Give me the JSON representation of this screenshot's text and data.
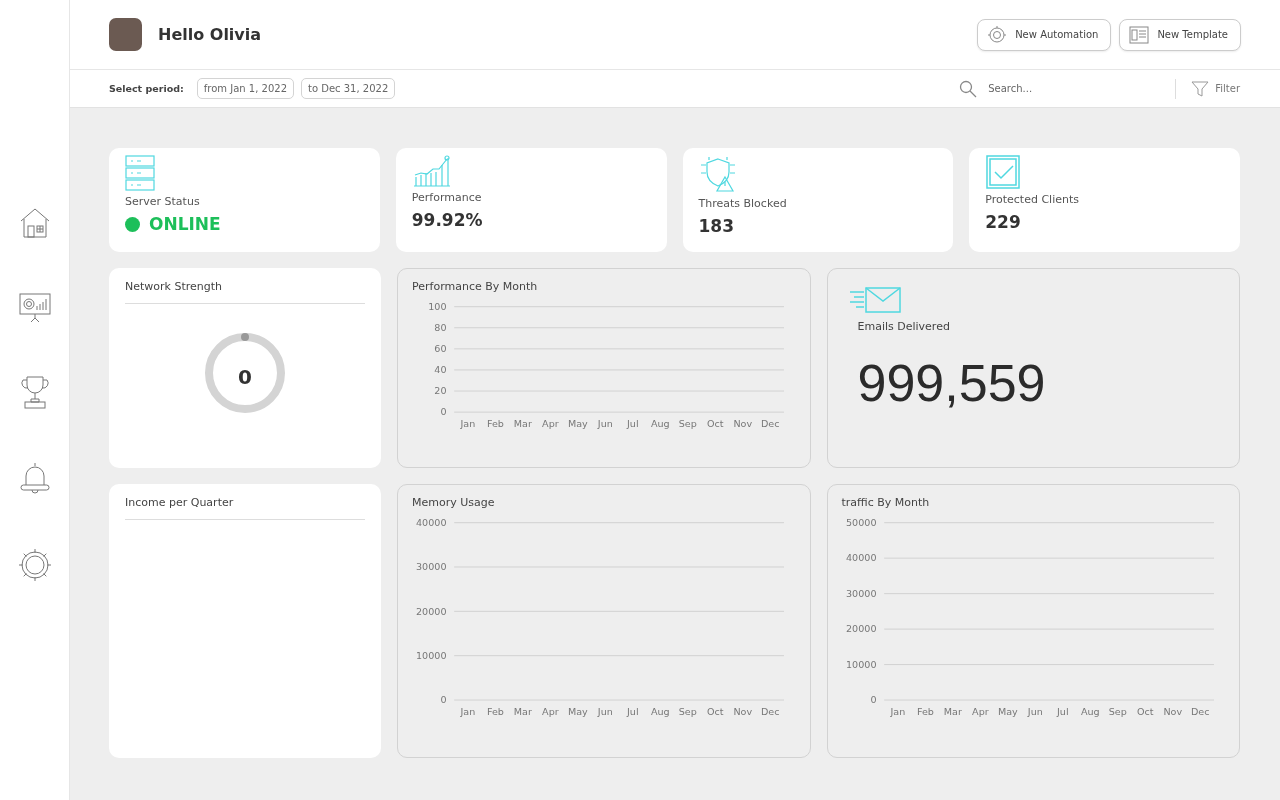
{
  "header": {
    "greeting": "Hello Olivia",
    "buttons": [
      {
        "label": "New Automation",
        "kind": "automation"
      },
      {
        "label": "New Template",
        "kind": "template"
      }
    ]
  },
  "period_bar": {
    "label": "Select period:",
    "from": "from Jan 1, 2022",
    "to": "to Dec 31, 2022",
    "search": {
      "placeholder": "Search..."
    },
    "filter": "Filter"
  },
  "stats": [
    {
      "kind": "server",
      "title": "Server Status",
      "status": {
        "label": "ONLINE",
        "color": "#1dbf5a"
      }
    },
    {
      "kind": "performance",
      "title": "Performance",
      "value": "99.92%"
    },
    {
      "kind": "threats",
      "title": "Threats Blocked",
      "value": "183"
    },
    {
      "kind": "clients",
      "title": "Protected Clients",
      "value": "229"
    }
  ],
  "network": {
    "title": "Network Strength",
    "level": 0,
    "reading": "0"
  },
  "performance_chart": {
    "title": "Performance By Month",
    "chart_data": {
      "type": "line",
      "categories": [
        "Jan",
        "Feb",
        "Mar",
        "Apr",
        "May",
        "Jun",
        "Jul",
        "Aug",
        "Sep",
        "Oct",
        "Nov",
        "Dec"
      ],
      "grid": true,
      "ylim": [
        0,
        100
      ],
      "yticks": [
        0,
        20,
        40,
        60,
        80,
        100
      ]
    }
  },
  "emails": {
    "title": "Emails Delivered",
    "value": "999,559"
  },
  "income": {
    "title": "Income per Quarter"
  },
  "memory_chart": {
    "title": "Memory Usage",
    "chart_data": {
      "type": "line",
      "categories": [
        "Jan",
        "Feb",
        "Mar",
        "Apr",
        "May",
        "Jun",
        "Jul",
        "Aug",
        "Sep",
        "Oct",
        "Nov",
        "Dec"
      ],
      "grid": true,
      "ylim": [
        0,
        40000
      ],
      "yticks": [
        0,
        10000,
        20000,
        30000,
        40000
      ]
    }
  },
  "traffic_chart": {
    "title": "traffic By Month",
    "chart_data": {
      "type": "line",
      "categories": [
        "Jan",
        "Feb",
        "Mar",
        "Apr",
        "May",
        "Jun",
        "Jul",
        "Aug",
        "Sep",
        "Oct",
        "Nov",
        "Dec"
      ],
      "grid": true,
      "ylim": [
        0,
        50000
      ],
      "yticks": [
        0,
        10000,
        20000,
        30000,
        40000,
        50000
      ]
    }
  }
}
